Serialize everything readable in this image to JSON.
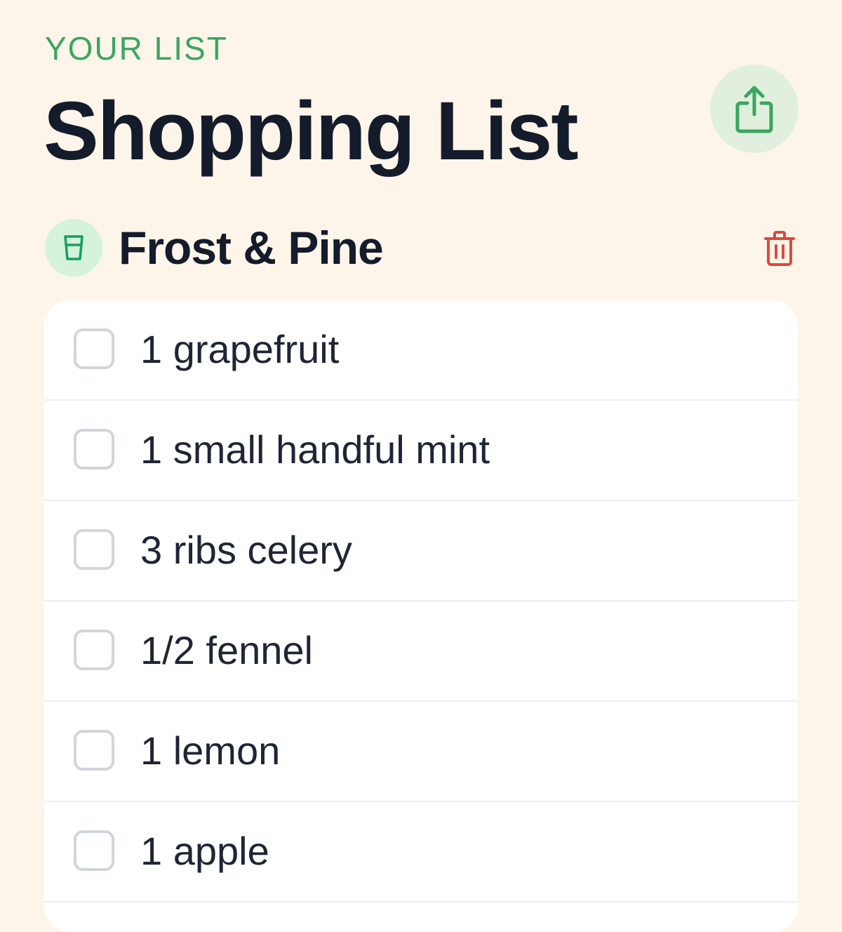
{
  "header": {
    "eyebrow": "YOUR LIST",
    "title": "Shopping List",
    "share_icon": "share-icon"
  },
  "section": {
    "title": "Frost & Pine",
    "badge_icon": "glass-icon",
    "delete_icon": "trash-icon"
  },
  "items": [
    {
      "label": "1 grapefruit",
      "checked": false
    },
    {
      "label": "1 small handful mint",
      "checked": false
    },
    {
      "label": "3 ribs celery",
      "checked": false
    },
    {
      "label": "1/2 fennel",
      "checked": false
    },
    {
      "label": "1 lemon",
      "checked": false
    },
    {
      "label": "1 apple",
      "checked": false
    }
  ],
  "colors": {
    "background": "#fdf5e9",
    "accent_green": "#3aa660",
    "title_dark": "#141b2b",
    "delete_red": "#e0483e",
    "share_bg": "#e1f0de",
    "badge_bg": "#d4f2dc"
  }
}
